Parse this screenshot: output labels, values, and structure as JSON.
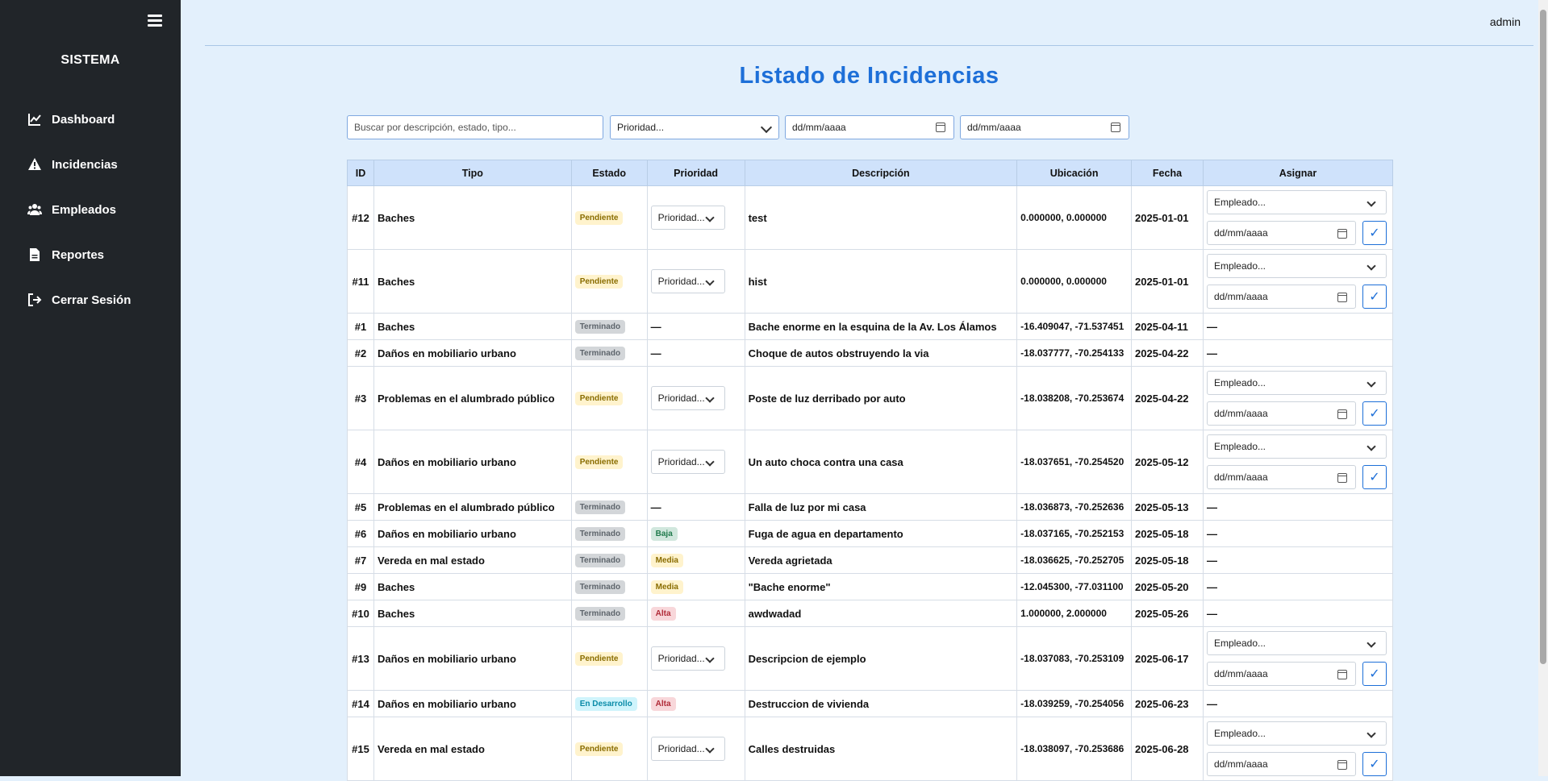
{
  "sidebar": {
    "brand": "SISTEMA",
    "items": [
      {
        "label": "Dashboard",
        "icon": "chart-line-icon"
      },
      {
        "label": "Incidencias",
        "icon": "warning-triangle-icon"
      },
      {
        "label": "Empleados",
        "icon": "users-icon"
      },
      {
        "label": "Reportes",
        "icon": "file-icon"
      },
      {
        "label": "Cerrar Sesión",
        "icon": "logout-icon"
      }
    ]
  },
  "header": {
    "user": "admin"
  },
  "page": {
    "title": "Listado de Incidencias"
  },
  "filters": {
    "search_placeholder": "Buscar por descripción, estado, tipo...",
    "priority_label": "Prioridad...",
    "date_from": "dd/mm/aaaa",
    "date_to": "dd/mm/aaaa"
  },
  "table": {
    "columns": [
      "ID",
      "Tipo",
      "Estado",
      "Prioridad",
      "Descripción",
      "Ubicación",
      "Fecha",
      "Asignar"
    ],
    "assign": {
      "employee_label": "Empleado...",
      "date_placeholder": "dd/mm/aaaa",
      "confirm": "✓"
    },
    "priority_select": "Prioridad...",
    "dash": "—",
    "rows": [
      {
        "id": "#12",
        "tipo": "Baches",
        "estado": "Pendiente",
        "prioridad": "",
        "descripcion": "test",
        "ubicacion": "0.000000, 0.000000",
        "fecha": "2025-01-01"
      },
      {
        "id": "#11",
        "tipo": "Baches",
        "estado": "Pendiente",
        "prioridad": "",
        "descripcion": "hist",
        "ubicacion": "0.000000, 0.000000",
        "fecha": "2025-01-01"
      },
      {
        "id": "#1",
        "tipo": "Baches",
        "estado": "Terminado",
        "prioridad": "—",
        "descripcion": "Bache enorme en la esquina de la Av. Los Álamos",
        "ubicacion": "-16.409047, -71.537451",
        "fecha": "2025-04-11"
      },
      {
        "id": "#2",
        "tipo": "Daños en mobiliario urbano",
        "estado": "Terminado",
        "prioridad": "—",
        "descripcion": "Choque de autos obstruyendo la via",
        "ubicacion": "-18.037777, -70.254133",
        "fecha": "2025-04-22"
      },
      {
        "id": "#3",
        "tipo": "Problemas en el alumbrado público",
        "estado": "Pendiente",
        "prioridad": "",
        "descripcion": "Poste de luz derribado por auto",
        "ubicacion": "-18.038208, -70.253674",
        "fecha": "2025-04-22"
      },
      {
        "id": "#4",
        "tipo": "Daños en mobiliario urbano",
        "estado": "Pendiente",
        "prioridad": "",
        "descripcion": "Un auto choca contra una casa",
        "ubicacion": "-18.037651, -70.254520",
        "fecha": "2025-05-12"
      },
      {
        "id": "#5",
        "tipo": "Problemas en el alumbrado público",
        "estado": "Terminado",
        "prioridad": "—",
        "descripcion": "Falla de luz por mi casa",
        "ubicacion": "-18.036873, -70.252636",
        "fecha": "2025-05-13"
      },
      {
        "id": "#6",
        "tipo": "Daños en mobiliario urbano",
        "estado": "Terminado",
        "prioridad": "Baja",
        "descripcion": "Fuga de agua en departamento",
        "ubicacion": "-18.037165, -70.252153",
        "fecha": "2025-05-18"
      },
      {
        "id": "#7",
        "tipo": "Vereda en mal estado",
        "estado": "Terminado",
        "prioridad": "Media",
        "descripcion": "Vereda agrietada",
        "ubicacion": "-18.036625, -70.252705",
        "fecha": "2025-05-18"
      },
      {
        "id": "#9",
        "tipo": "Baches",
        "estado": "Terminado",
        "prioridad": "Media",
        "descripcion": "\"Bache enorme\"",
        "ubicacion": "-12.045300, -77.031100",
        "fecha": "2025-05-20"
      },
      {
        "id": "#10",
        "tipo": "Baches",
        "estado": "Terminado",
        "prioridad": "Alta",
        "descripcion": "awdwadad",
        "ubicacion": "1.000000, 2.000000",
        "fecha": "2025-05-26"
      },
      {
        "id": "#13",
        "tipo": "Daños en mobiliario urbano",
        "estado": "Pendiente",
        "prioridad": "",
        "descripcion": "Descripcion de ejemplo",
        "ubicacion": "-18.037083, -70.253109",
        "fecha": "2025-06-17"
      },
      {
        "id": "#14",
        "tipo": "Daños en mobiliario urbano",
        "estado": "En Desarrollo",
        "prioridad": "Alta",
        "descripcion": "Destruccion de vivienda",
        "ubicacion": "-18.039259, -70.254056",
        "fecha": "2025-06-23"
      },
      {
        "id": "#15",
        "tipo": "Vereda en mal estado",
        "estado": "Pendiente",
        "prioridad": "",
        "descripcion": "Calles destruidas",
        "ubicacion": "-18.038097, -70.253686",
        "fecha": "2025-06-28"
      }
    ]
  }
}
